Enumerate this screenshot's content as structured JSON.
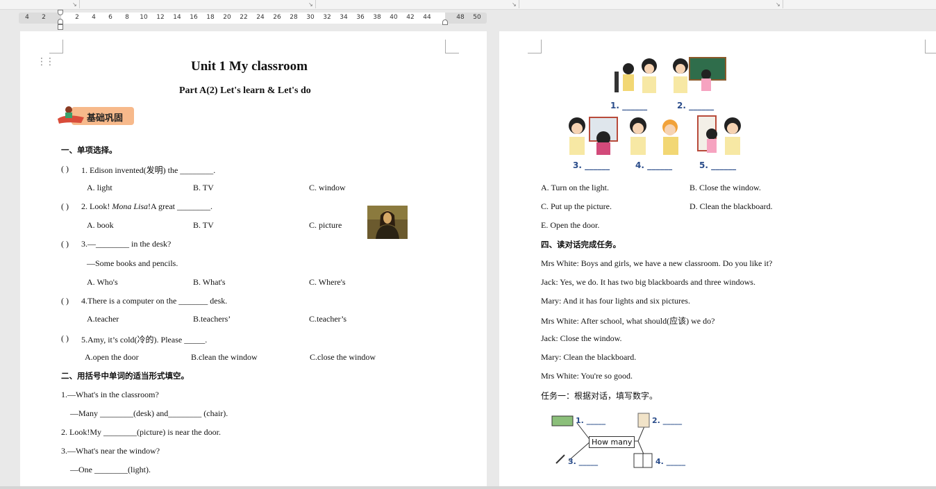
{
  "ruler": {
    "ticks": [
      "4",
      "2",
      "2",
      "4",
      "6",
      "8",
      "10",
      "12",
      "14",
      "16",
      "18",
      "20",
      "22",
      "24",
      "26",
      "28",
      "30",
      "32",
      "34",
      "36",
      "38",
      "40",
      "42",
      "44",
      "48",
      "50"
    ]
  },
  "left": {
    "title": "Unit 1 My classroom",
    "subtitle": "Part A(2) Let's learn & Let's do",
    "banner": "基础巩固",
    "s1": {
      "heading": "一、单项选择。",
      "q1": {
        "paren": "(        )",
        "text": "1. Edison invented(发明) the ________.",
        "a": "A. light",
        "b": "B. TV",
        "c": "C. window"
      },
      "q2": {
        "paren": "(        )",
        "pre": "2. Look! ",
        "italic": "Mona Lisa",
        "post": "!A great ________.",
        "a": "A. book",
        "b": "B. TV",
        "c": "C. picture"
      },
      "q3": {
        "paren": "(        )",
        "text": "3.—________ in the desk?",
        "reply": "—Some books and pencils.",
        "a": "A. Who's",
        "b": "B. What's",
        "c": "C. Where's"
      },
      "q4": {
        "paren": "(        )",
        "text": "4.There is a computer on the _______ desk.",
        "a": "A.teacher",
        "b": "B.teachers’",
        "c": "C.teacher’s"
      },
      "q5": {
        "paren": "(        )",
        "text": "5.Amy, it’s cold(冷的). Please _____.",
        "a": "A.open the door",
        "b": "B.clean the window",
        "c": "C.close the window"
      }
    },
    "s2": {
      "heading": "二、用括号中单词的适当形式填空。",
      "l1": "1.—What's in the classroom?",
      "l2": "—Many ________(desk) and________ (chair).",
      "l3": "2. Look!My ________(picture) is near the door.",
      "l4": "3.—What's near the window?",
      "l5": "—One ________(light)."
    }
  },
  "right": {
    "pic_labels": {
      "p1": "1. ______",
      "p2": "2. ______",
      "p3": "3. ______",
      "p4": "4. ______",
      "p5": "5. ______"
    },
    "options": {
      "a": "A. Turn on the light.",
      "b": "B. Close the window.",
      "c": "C. Put up the picture.",
      "d": "D. Clean the blackboard.",
      "e": "E. Open the door."
    },
    "s4": {
      "heading": "四、读对话完成任务。",
      "d1": "Mrs White: Boys and girls, we have a new classroom. Do you like it?",
      "d2": "Jack: Yes, we do. It has two big blackboards and three windows.",
      "d3": "Mary: And it has four lights and six pictures.",
      "d4": "Mrs White: After school, what should(应该) we do?",
      "d5": "Jack: Close the window.",
      "d6": "Mary: Clean the blackboard.",
      "d7": "Mrs White: You're so good.",
      "task1": "任务一：根据对话，填写数字。"
    },
    "mindmap": {
      "center": "How many",
      "n1": "1. _____",
      "n2": "2. _____",
      "n3": "3. _____",
      "n4": "4. _____"
    }
  },
  "colors": {
    "banner": "#f7b98b",
    "page": "#ffffff",
    "workspace": "#e9e9e9"
  }
}
